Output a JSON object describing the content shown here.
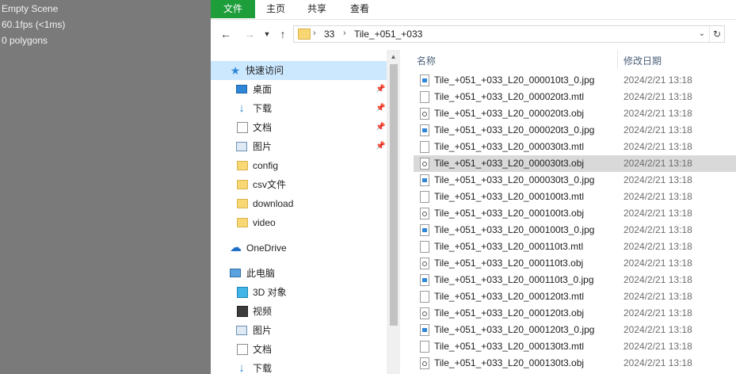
{
  "viewport": {
    "stats": [
      "Empty Scene",
      "60.1fps (<1ms)",
      "0 polygons"
    ]
  },
  "ribbon": {
    "tabs": [
      "文件",
      "主页",
      "共享",
      "查看"
    ]
  },
  "address": {
    "crumbs": [
      "33",
      "Tile_+051_+033"
    ]
  },
  "nav": {
    "quick_access": "快速访问",
    "pinned": [
      {
        "label": "桌面",
        "icon": "desktop-icon"
      },
      {
        "label": "下载",
        "icon": "download-icon"
      },
      {
        "label": "文档",
        "icon": "document-icon"
      },
      {
        "label": "图片",
        "icon": "pictures-icon"
      }
    ],
    "folders": [
      "config",
      "csv文件",
      "download",
      "video"
    ],
    "onedrive": "OneDrive",
    "this_pc": "此电脑",
    "pc_items": [
      {
        "label": "3D 对象",
        "icon": "3d-objects-icon"
      },
      {
        "label": "视频",
        "icon": "video-icon"
      },
      {
        "label": "图片",
        "icon": "pictures-icon"
      },
      {
        "label": "文档",
        "icon": "document-icon"
      },
      {
        "label": "下载",
        "icon": "download-icon"
      }
    ]
  },
  "files": {
    "col_name": "名称",
    "col_date": "修改日期",
    "rows": [
      {
        "name": "Tile_+051_+033_L20_000010t3_0.jpg",
        "date": "2024/2/21 13:18",
        "type": "jpg"
      },
      {
        "name": "Tile_+051_+033_L20_000020t3.mtl",
        "date": "2024/2/21 13:18",
        "type": "mtl"
      },
      {
        "name": "Tile_+051_+033_L20_000020t3.obj",
        "date": "2024/2/21 13:18",
        "type": "obj"
      },
      {
        "name": "Tile_+051_+033_L20_000020t3_0.jpg",
        "date": "2024/2/21 13:18",
        "type": "jpg"
      },
      {
        "name": "Tile_+051_+033_L20_000030t3.mtl",
        "date": "2024/2/21 13:18",
        "type": "mtl"
      },
      {
        "name": "Tile_+051_+033_L20_000030t3.obj",
        "date": "2024/2/21 13:18",
        "type": "obj"
      },
      {
        "name": "Tile_+051_+033_L20_000030t3_0.jpg",
        "date": "2024/2/21 13:18",
        "type": "jpg"
      },
      {
        "name": "Tile_+051_+033_L20_000100t3.mtl",
        "date": "2024/2/21 13:18",
        "type": "mtl"
      },
      {
        "name": "Tile_+051_+033_L20_000100t3.obj",
        "date": "2024/2/21 13:18",
        "type": "obj"
      },
      {
        "name": "Tile_+051_+033_L20_000100t3_0.jpg",
        "date": "2024/2/21 13:18",
        "type": "jpg"
      },
      {
        "name": "Tile_+051_+033_L20_000110t3.mtl",
        "date": "2024/2/21 13:18",
        "type": "mtl"
      },
      {
        "name": "Tile_+051_+033_L20_000110t3.obj",
        "date": "2024/2/21 13:18",
        "type": "obj"
      },
      {
        "name": "Tile_+051_+033_L20_000110t3_0.jpg",
        "date": "2024/2/21 13:18",
        "type": "jpg"
      },
      {
        "name": "Tile_+051_+033_L20_000120t3.mtl",
        "date": "2024/2/21 13:18",
        "type": "mtl"
      },
      {
        "name": "Tile_+051_+033_L20_000120t3.obj",
        "date": "2024/2/21 13:18",
        "type": "obj"
      },
      {
        "name": "Tile_+051_+033_L20_000120t3_0.jpg",
        "date": "2024/2/21 13:18",
        "type": "jpg"
      },
      {
        "name": "Tile_+051_+033_L20_000130t3.mtl",
        "date": "2024/2/21 13:18",
        "type": "mtl"
      },
      {
        "name": "Tile_+051_+033_L20_000130t3.obj",
        "date": "2024/2/21 13:18",
        "type": "obj"
      }
    ]
  }
}
